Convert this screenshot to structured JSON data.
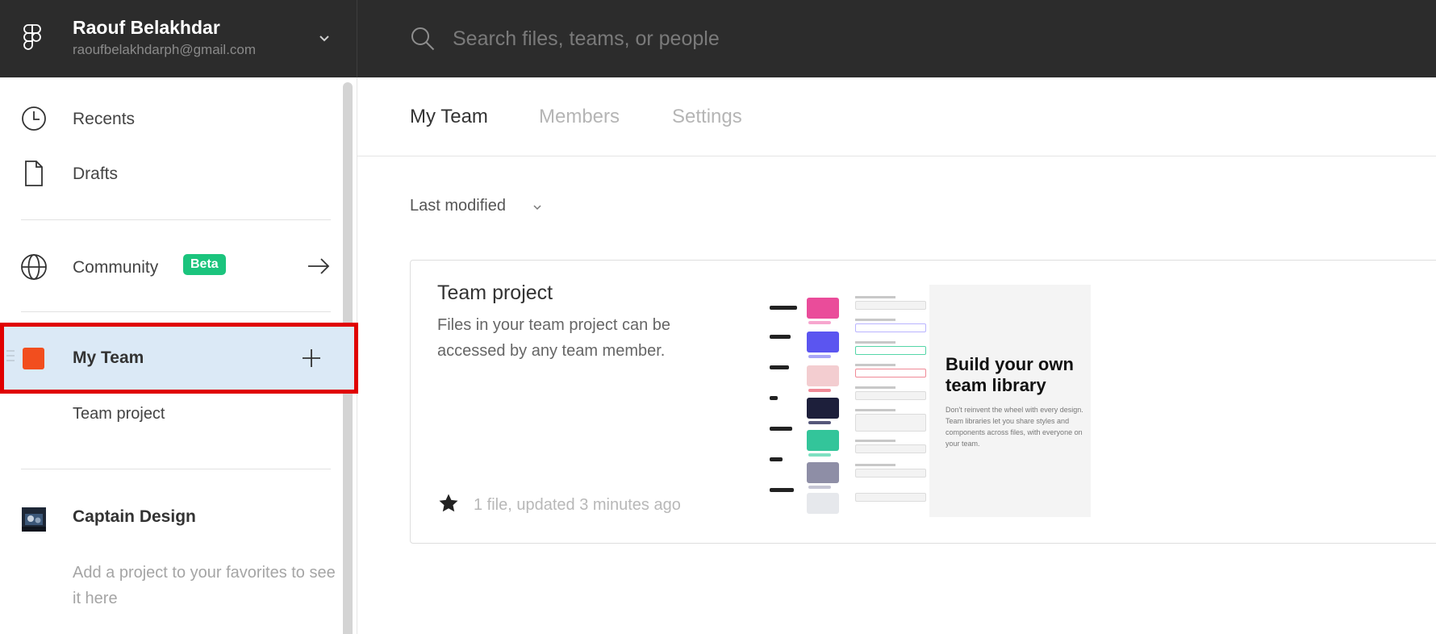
{
  "account": {
    "name": "Raouf Belakhdar",
    "email": "raoufbelakhdarph@gmail.com"
  },
  "search": {
    "placeholder": "Search files, teams, or people"
  },
  "sidebar": {
    "recents": "Recents",
    "drafts": "Drafts",
    "community": "Community",
    "community_badge": "Beta",
    "team": "My Team",
    "team_project": "Team project",
    "other_team": "Captain Design",
    "favorites_hint": "Add a project to your favorites to see it here"
  },
  "main": {
    "tabs": [
      {
        "label": "My Team",
        "active": true
      },
      {
        "label": "Members",
        "active": false
      },
      {
        "label": "Settings",
        "active": false
      }
    ],
    "sort_label": "Last modified",
    "card": {
      "title": "Team project",
      "description": "Files in your team project can be accessed by any team member.",
      "meta": "1 file, updated 3 minutes ago",
      "thumbnail": {
        "heading": "Build your own team library",
        "body": "Don't reinvent the wheel with every design. Team libraries let you share styles and components across files, with everyone on your team."
      }
    }
  },
  "colors": {
    "topbar": "#2c2c2c",
    "selected_row": "#dbe9f6",
    "highlight_outline": "#e00000",
    "team_swatch": "#f24e1e",
    "beta_badge": "#1bc47d"
  }
}
